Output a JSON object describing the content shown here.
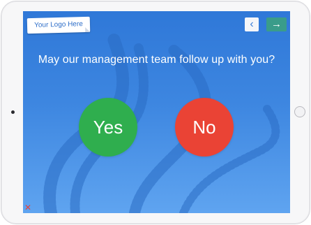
{
  "device": {
    "type": "tablet",
    "frame_color": "#f7f7f8"
  },
  "screen": {
    "background_colors": [
      "#2f78d8",
      "#5fa4f0"
    ]
  },
  "logo": {
    "label": "Your Logo Here"
  },
  "nav": {
    "back_icon": "chevron-left-icon",
    "back_glyph": "‹",
    "next_icon": "arrow-right-icon",
    "next_glyph": "→",
    "next_color": "#3a9c8a"
  },
  "question": {
    "text": "May our management team follow up with you?"
  },
  "answers": {
    "yes_label": "Yes",
    "yes_color": "#2fae4e",
    "no_label": "No",
    "no_color": "#ea4335"
  },
  "close": {
    "icon": "close-icon",
    "glyph": "✕",
    "color": "#e8413a"
  }
}
